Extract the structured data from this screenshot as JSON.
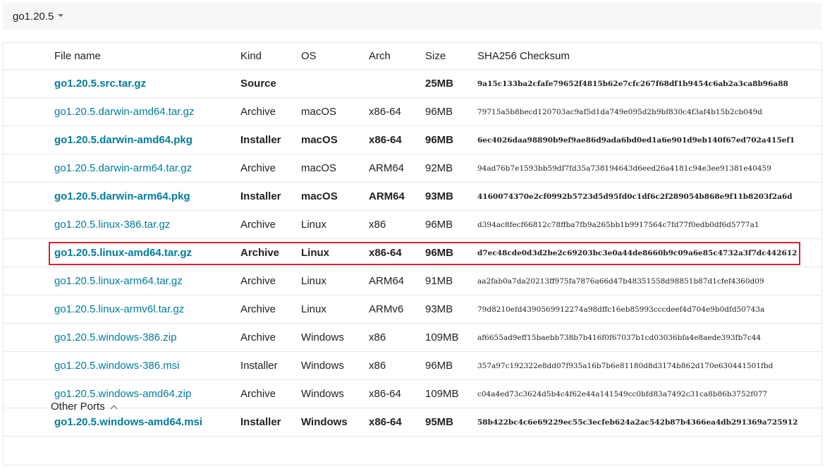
{
  "version_selector": {
    "label": "go1.20.5",
    "icon": "chevron-down-icon"
  },
  "table": {
    "headers": {
      "file": "File name",
      "kind": "Kind",
      "os": "OS",
      "arch": "Arch",
      "size": "Size",
      "sha": "SHA256 Checksum"
    },
    "rows": [
      {
        "file": "go1.20.5.src.tar.gz",
        "kind": "Source",
        "os": "",
        "arch": "",
        "size": "25MB",
        "sha": "9a15c133ba2cfafe79652f4815b62e7cfc267f68df1b9454c6ab2a3ca8b96a88",
        "bold": true
      },
      {
        "file": "go1.20.5.darwin-amd64.tar.gz",
        "kind": "Archive",
        "os": "macOS",
        "arch": "x86-64",
        "size": "96MB",
        "sha": "79715a5b8becd120703ac9af5d1da749e095d2b9bf830c4f3af4b15b2cb049d",
        "bold": false
      },
      {
        "file": "go1.20.5.darwin-amd64.pkg",
        "kind": "Installer",
        "os": "macOS",
        "arch": "x86-64",
        "size": "96MB",
        "sha": "6ec4026daa98890b9ef9ae86d9ada6bd0ed1a6e901d9eb140f67ed702a415ef1",
        "bold": true
      },
      {
        "file": "go1.20.5.darwin-arm64.tar.gz",
        "kind": "Archive",
        "os": "macOS",
        "arch": "ARM64",
        "size": "92MB",
        "sha": "94ad76b7e1593bb59df7fd35a738194643d6eed26a4181c94e3ee91381e40459",
        "bold": false
      },
      {
        "file": "go1.20.5.darwin-arm64.pkg",
        "kind": "Installer",
        "os": "macOS",
        "arch": "ARM64",
        "size": "93MB",
        "sha": "4160074370e2cf0992b5723d5d95fd0c1df6c2f289054b868e9f11b8203f2a6d",
        "bold": true
      },
      {
        "file": "go1.20.5.linux-386.tar.gz",
        "kind": "Archive",
        "os": "Linux",
        "arch": "x86",
        "size": "96MB",
        "sha": "d394ac8fecf66812c78ffba7fb9a265bb1b9917564c7fd77f0edb0df6d5777a1",
        "bold": false
      },
      {
        "file": "go1.20.5.linux-amd64.tar.gz",
        "kind": "Archive",
        "os": "Linux",
        "arch": "x86-64",
        "size": "96MB",
        "sha": "d7ec48cde0d3d2be2c69203bc3e0a44de8660b9c09a6e85c4732a3f7dc442612",
        "bold": true,
        "highlighted": true
      },
      {
        "file": "go1.20.5.linux-arm64.tar.gz",
        "kind": "Archive",
        "os": "Linux",
        "arch": "ARM64",
        "size": "91MB",
        "sha": "aa2fab0a7da20213ff975fa7876a66d47b48351558d98851b87d1cfef4360d09",
        "bold": false
      },
      {
        "file": "go1.20.5.linux-armv6l.tar.gz",
        "kind": "Archive",
        "os": "Linux",
        "arch": "ARMv6",
        "size": "93MB",
        "sha": "79d8210efd4390569912274a98dffc16eb85993cccdeef4d704e9b0dfd50743a",
        "bold": false
      },
      {
        "file": "go1.20.5.windows-386.zip",
        "kind": "Archive",
        "os": "Windows",
        "arch": "x86",
        "size": "109MB",
        "sha": "af6655ad9eff15baebb738b7b416f0f67037b1cd03036bfa4e8aede393fb7c44",
        "bold": false
      },
      {
        "file": "go1.20.5.windows-386.msi",
        "kind": "Installer",
        "os": "Windows",
        "arch": "x86",
        "size": "96MB",
        "sha": "357a97c192322e8dd07f935a16b7b6e81180d8d3174b862d170e630441501fbd",
        "bold": false
      },
      {
        "file": "go1.20.5.windows-amd64.zip",
        "kind": "Archive",
        "os": "Windows",
        "arch": "x86-64",
        "size": "109MB",
        "sha": "c04a4ed73c3624d5b4c4f62e44a141549cc0bfd83a7492c31ca8b86b3752f077",
        "bold": false
      },
      {
        "file": "go1.20.5.windows-amd64.msi",
        "kind": "Installer",
        "os": "Windows",
        "arch": "x86-64",
        "size": "95MB",
        "sha": "58b422bc4c6e69229ec55c3ecfeb624a2ac542b87b4366ea4db291369a725912",
        "bold": true
      }
    ]
  },
  "other_ports": {
    "label": "Other Ports",
    "icon": "chevron-up-icon"
  },
  "colors": {
    "link": "#007d9c",
    "highlight": "#d9212f",
    "border": "#e6e6e6"
  }
}
